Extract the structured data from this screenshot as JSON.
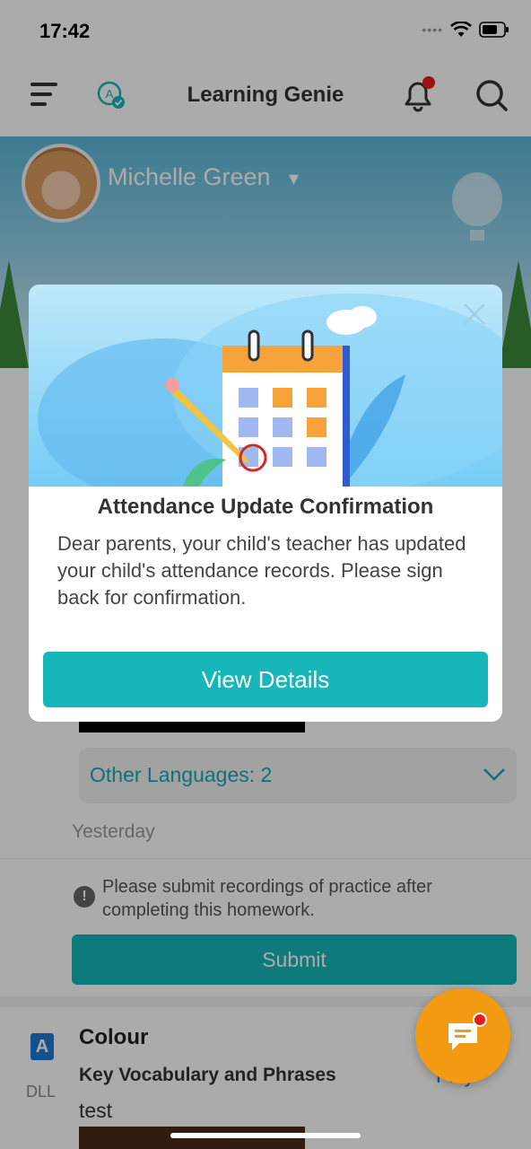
{
  "status_bar": {
    "time": "17:42",
    "signal_dots": "••••"
  },
  "header": {
    "title": "Learning Genie",
    "menu_icon": "menu-icon",
    "switch_icon": "language-check-icon",
    "bell_icon": "bell-icon",
    "search_icon": "search-icon"
  },
  "profile": {
    "name": "Michelle Green",
    "dropdown_icon": "▾"
  },
  "feed": {
    "other_languages": "Other Languages: 2",
    "date_label": "Yesterday",
    "notice": "Please submit recordings of practice after completing this homework.",
    "submit_label": "Submit",
    "card": {
      "badge": "A",
      "badge_caption": "DLL",
      "title": "Colour",
      "subtitle": "Key Vocabulary and Phrases",
      "text": "test",
      "play_label": "Play"
    }
  },
  "modal": {
    "title": "Attendance Update Confirmation",
    "body": "Dear parents, your child's teacher has updated your child's attendance records. Please sign back for confirmation.",
    "button_label": "View Details",
    "close_icon": "close-icon"
  },
  "colors": {
    "accent": "#17b6b8",
    "fab": "#f29a12",
    "badge_red": "#e61b1b"
  }
}
